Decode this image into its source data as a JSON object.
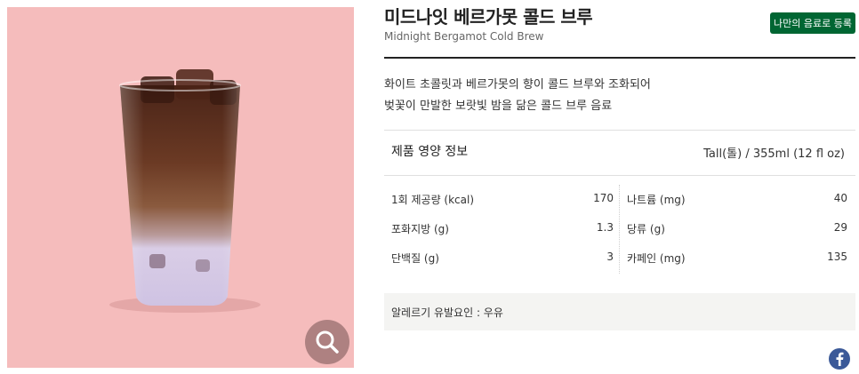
{
  "product": {
    "name_ko": "미드나잇 베르가못 콜드 브루",
    "name_en": "Midnight Bergamot Cold Brew",
    "register_label": "나만의 음료로 등록",
    "description": [
      "화이트 초콜릿과 베르가못의 향이 콜드 브루와 조화되어",
      "벚꽃이 만발한 보랏빛 밤을 닮은 콜드 브루 음료"
    ],
    "image_background": "#f5bcbc"
  },
  "nutrition": {
    "heading": "제품 영양 정보",
    "serving": "Tall(톨) / 355ml (12 fl oz)",
    "left": [
      {
        "label": "1회 제공량 (kcal)",
        "value": "170"
      },
      {
        "label": "포화지방 (g)",
        "value": "1.3"
      },
      {
        "label": "단백질 (g)",
        "value": "3"
      }
    ],
    "right": [
      {
        "label": "나트륨 (mg)",
        "value": "40"
      },
      {
        "label": "당류 (g)",
        "value": "29"
      },
      {
        "label": "카페인 (mg)",
        "value": "135"
      }
    ]
  },
  "allergy": {
    "text": "알레르기 유발요인 : 우유"
  },
  "icons": {
    "zoom": "magnifier-icon",
    "share": "facebook-icon"
  },
  "colors": {
    "brand_green": "#006633",
    "facebook_blue": "#3b5998"
  }
}
